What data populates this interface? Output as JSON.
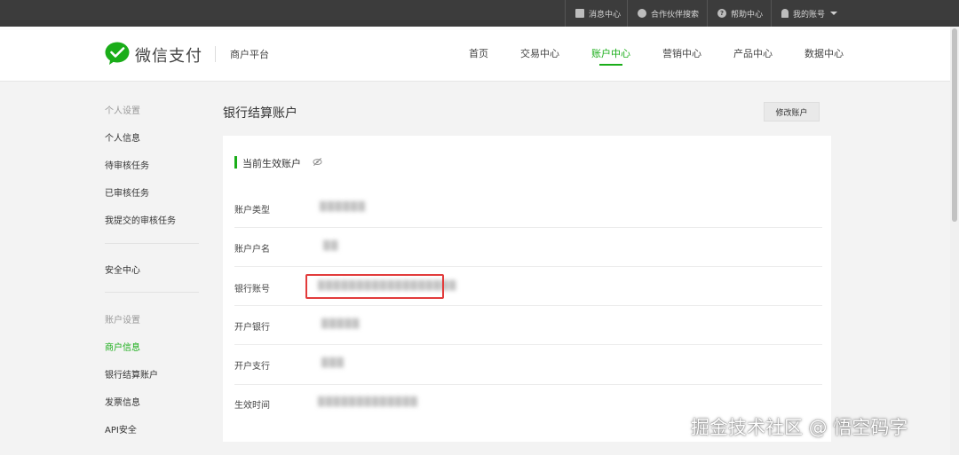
{
  "topbar": {
    "messages": "消息中心",
    "partner_search": "合作伙伴搜索",
    "help": "帮助中心",
    "account": "我的账号"
  },
  "header": {
    "brand": "微信支付",
    "merchant_platform": "商户平台",
    "nav": [
      "首页",
      "交易中心",
      "账户中心",
      "营销中心",
      "产品中心",
      "数据中心"
    ],
    "active_nav": "账户中心"
  },
  "sidebar": {
    "group_personal": "个人设置",
    "personal_items": [
      "个人信息",
      "待审核任务",
      "已审核任务",
      "我提交的审核任务"
    ],
    "security": "安全中心",
    "group_account": "账户设置",
    "account_items": [
      "商户信息",
      "银行结算账户",
      "发票信息",
      "API安全"
    ],
    "active_item": "商户信息"
  },
  "main": {
    "title": "银行结算账户",
    "edit_button": "修改账户",
    "card_title": "当前生效账户",
    "rows": [
      {
        "label": "账户类型",
        "value": "▒▒▒▒▒▒"
      },
      {
        "label": "账户户名",
        "value": "▒▒"
      },
      {
        "label": "银行账号",
        "value": "▒▒▒▒▒▒▒▒▒▒▒▒▒▒▒▒▒▒"
      },
      {
        "label": "开户银行",
        "value": "▒▒▒▒▒"
      },
      {
        "label": "开户支行",
        "value": "▒▒▒"
      },
      {
        "label": "生效时间",
        "value": "▒▒▒▒▒▒▒▒▒▒▒▒▒"
      }
    ]
  },
  "watermark": "掘金技术社区 @ 悟空码字",
  "colors": {
    "accent": "#1aad19",
    "topbar": "#3c3c3c",
    "highlight": "#e23b3b"
  }
}
